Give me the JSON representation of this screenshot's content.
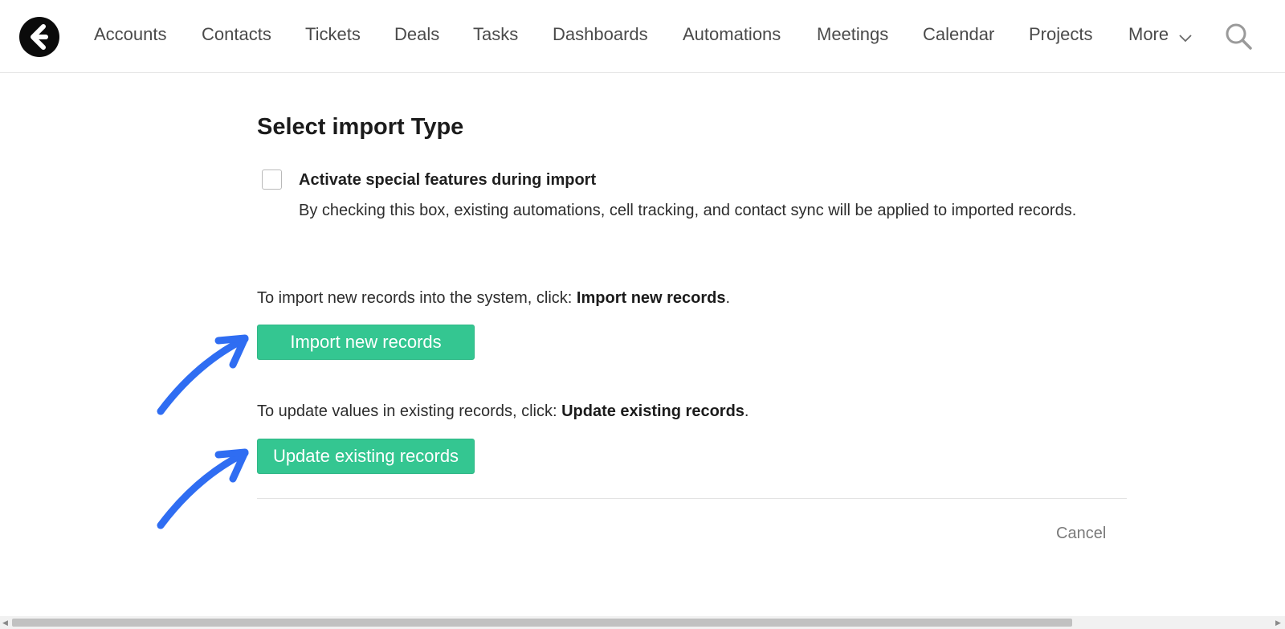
{
  "nav": {
    "items": [
      {
        "label": "Accounts"
      },
      {
        "label": "Contacts"
      },
      {
        "label": "Tickets"
      },
      {
        "label": "Deals"
      },
      {
        "label": "Tasks"
      },
      {
        "label": "Dashboards"
      },
      {
        "label": "Automations"
      },
      {
        "label": "Meetings"
      },
      {
        "label": "Calendar"
      },
      {
        "label": "Projects"
      },
      {
        "label": "More"
      }
    ],
    "logo_icon": "brand-logo-icon",
    "more_icon": "chevron-down-icon",
    "search_icon": "search-icon"
  },
  "main": {
    "title": "Select import Type",
    "special_features": {
      "label": "Activate special features during import",
      "description": "By checking this box, existing automations, cell tracking, and contact sync will be applied to imported records.",
      "checked": false
    },
    "import_new": {
      "instruction_prefix": "To import new records into the system, click: ",
      "instruction_bold": "Import new records",
      "instruction_suffix": ".",
      "button_label": "Import new records"
    },
    "update_existing": {
      "instruction_prefix": "To update values in existing records, click: ",
      "instruction_bold": "Update existing records",
      "instruction_suffix": ".",
      "button_label": "Update existing records"
    },
    "cancel_label": "Cancel"
  },
  "colors": {
    "accent_button": "#34c691",
    "annotation_arrow": "#2f6df2"
  }
}
